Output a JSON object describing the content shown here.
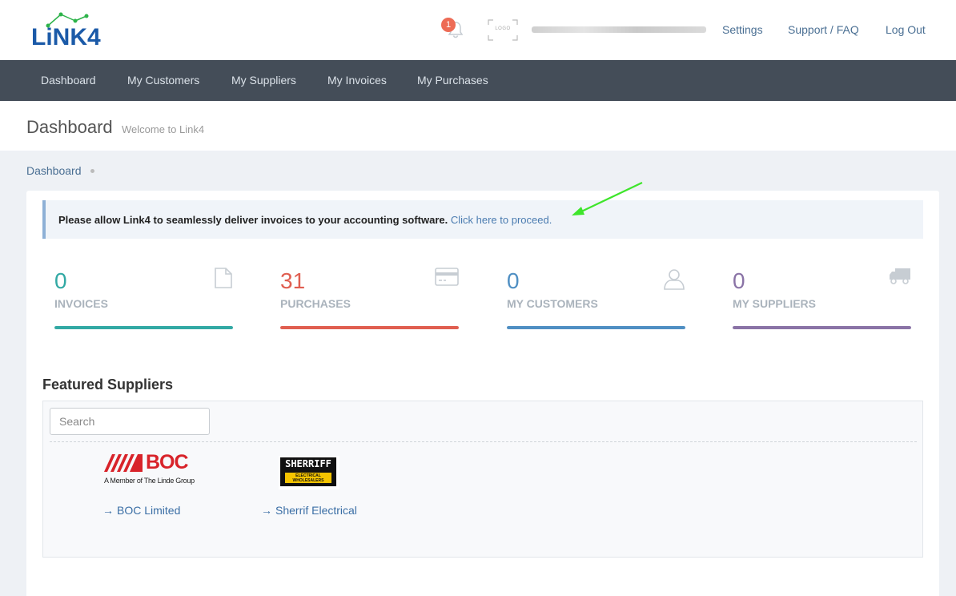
{
  "brand": {
    "logo_text": "LiNK4"
  },
  "header": {
    "notification_count": "1",
    "company_logo_text": "LOGO",
    "links": {
      "settings": "Settings",
      "support": "Support / FAQ",
      "logout": "Log Out"
    }
  },
  "nav": {
    "items": [
      {
        "label": "Dashboard"
      },
      {
        "label": "My Customers"
      },
      {
        "label": "My Suppliers"
      },
      {
        "label": "My Invoices"
      },
      {
        "label": "My Purchases"
      }
    ]
  },
  "page": {
    "title": "Dashboard",
    "subtitle": "Welcome to Link4",
    "breadcrumb": "Dashboard"
  },
  "alert": {
    "text": "Please allow Link4 to seamlessly deliver invoices to your accounting software.",
    "link": "Click here to proceed."
  },
  "stats": [
    {
      "value": "0",
      "label": "INVOICES",
      "color": "#32a9a4",
      "icon": "file-icon",
      "progress_percent": 100
    },
    {
      "value": "31",
      "label": "PURCHASES",
      "color": "#e05e50",
      "icon": "credit-card-icon",
      "progress_percent": 100
    },
    {
      "value": "0",
      "label": "MY CUSTOMERS",
      "color": "#4f8fc3",
      "icon": "user-icon",
      "progress_percent": 100
    },
    {
      "value": "0",
      "label": "MY SUPPLIERS",
      "color": "#8a73a6",
      "icon": "truck-icon",
      "progress_percent": 100
    }
  ],
  "featured": {
    "title": "Featured Suppliers",
    "search_placeholder": "Search",
    "suppliers": [
      {
        "name": "BOC Limited",
        "logo_main": "BOC",
        "logo_sub": "A Member of The Linde Group"
      },
      {
        "name": "Sherrif Electrical",
        "logo_main": "SHERRIFF",
        "logo_sub": "ELECTRICAL WHOLESALERS"
      }
    ]
  },
  "colors": {
    "nav_bg": "#444d58",
    "link": "#4a6f93",
    "brand_blue": "#1b5aa8",
    "brand_green": "#2db34a"
  }
}
